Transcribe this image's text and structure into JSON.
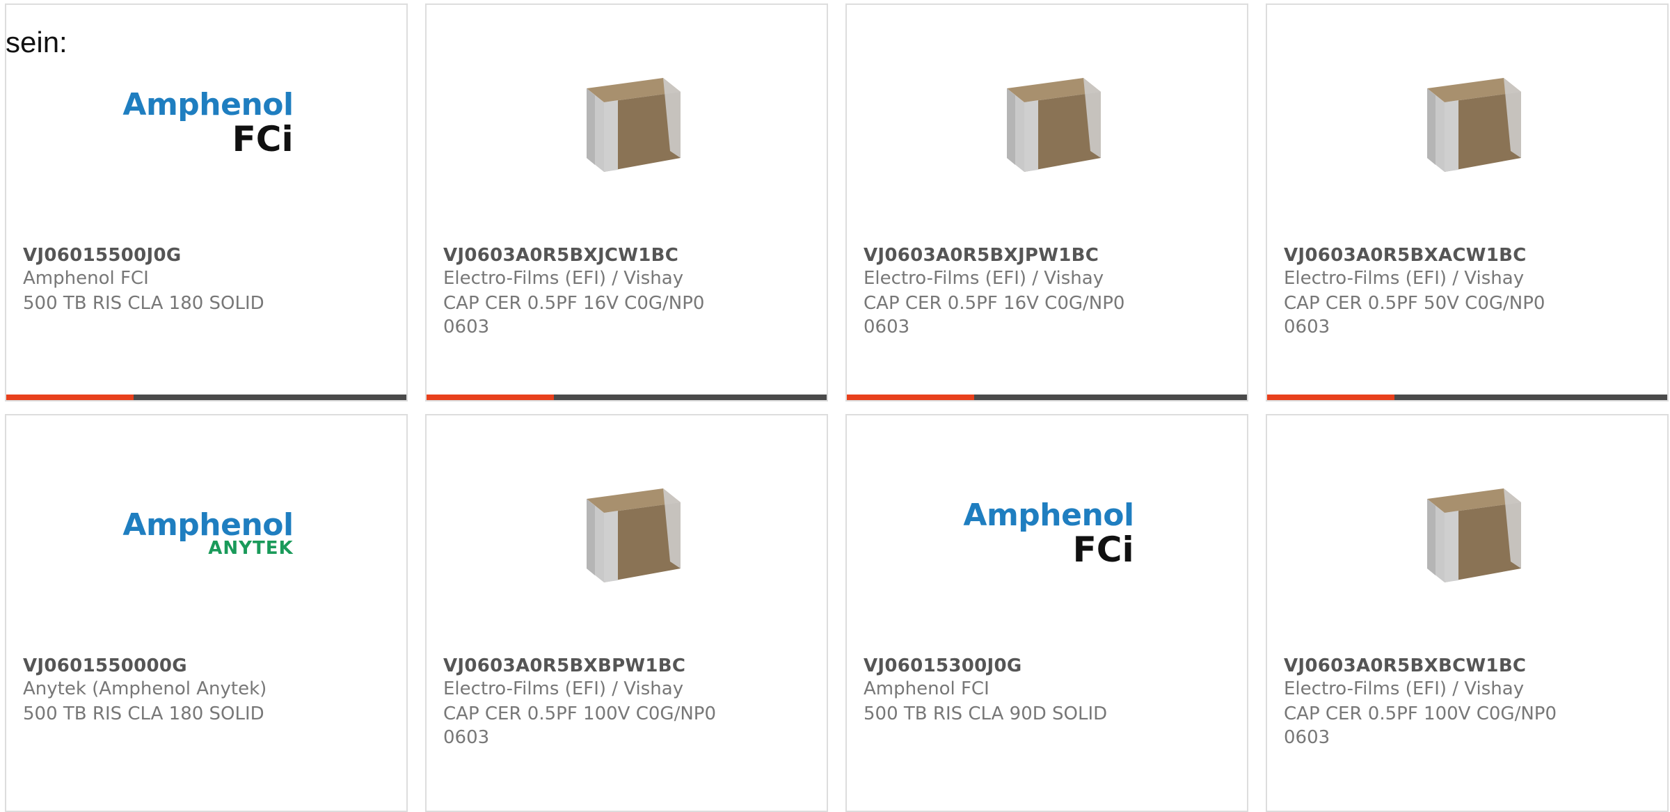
{
  "intro_text": "sein:",
  "colors": {
    "accent": "#e8401c",
    "bar": "#4a4a4a",
    "border": "#dddddd",
    "brand_blue": "#1f7ec0",
    "brand_green": "#1a9a5a"
  },
  "cards": [
    {
      "part": "VJ06015500J0G",
      "manufacturer": "Amphenol FCI",
      "description": "500 TB RIS CLA 180 SOLID",
      "image": "amphenol-fci-logo",
      "logo": {
        "brand": "Amphenol",
        "sub": "FCi"
      }
    },
    {
      "part": "VJ0603A0R5BXJCW1BC",
      "manufacturer": "Electro-Films (EFI) / Vishay",
      "description": "CAP CER 0.5PF 16V C0G/NP0 0603",
      "image": "ceramic-capacitor-chip"
    },
    {
      "part": "VJ0603A0R5BXJPW1BC",
      "manufacturer": "Electro-Films (EFI) / Vishay",
      "description": "CAP CER 0.5PF 16V C0G/NP0 0603",
      "image": "ceramic-capacitor-chip"
    },
    {
      "part": "VJ0603A0R5BXACW1BC",
      "manufacturer": "Electro-Films (EFI) / Vishay",
      "description": "CAP CER 0.5PF 50V C0G/NP0 0603",
      "image": "ceramic-capacitor-chip"
    },
    {
      "part": "VJ0601550000G",
      "manufacturer": "Anytek (Amphenol Anytek)",
      "description": "500 TB RIS CLA 180 SOLID",
      "image": "amphenol-anytek-logo",
      "logo": {
        "brand": "Amphenol",
        "sub": "ANYTEK"
      }
    },
    {
      "part": "VJ0603A0R5BXBPW1BC",
      "manufacturer": "Electro-Films (EFI) / Vishay",
      "description": "CAP CER 0.5PF 100V C0G/NP0 0603",
      "image": "ceramic-capacitor-chip"
    },
    {
      "part": "VJ06015300J0G",
      "manufacturer": "Amphenol FCI",
      "description": "500 TB RIS CLA 90D SOLID",
      "image": "amphenol-fci-logo",
      "logo": {
        "brand": "Amphenol",
        "sub": "FCi"
      }
    },
    {
      "part": "VJ0603A0R5BXBCW1BC",
      "manufacturer": "Electro-Films (EFI) / Vishay",
      "description": "CAP CER 0.5PF 100V C0G/NP0 0603",
      "image": "ceramic-capacitor-chip"
    }
  ]
}
